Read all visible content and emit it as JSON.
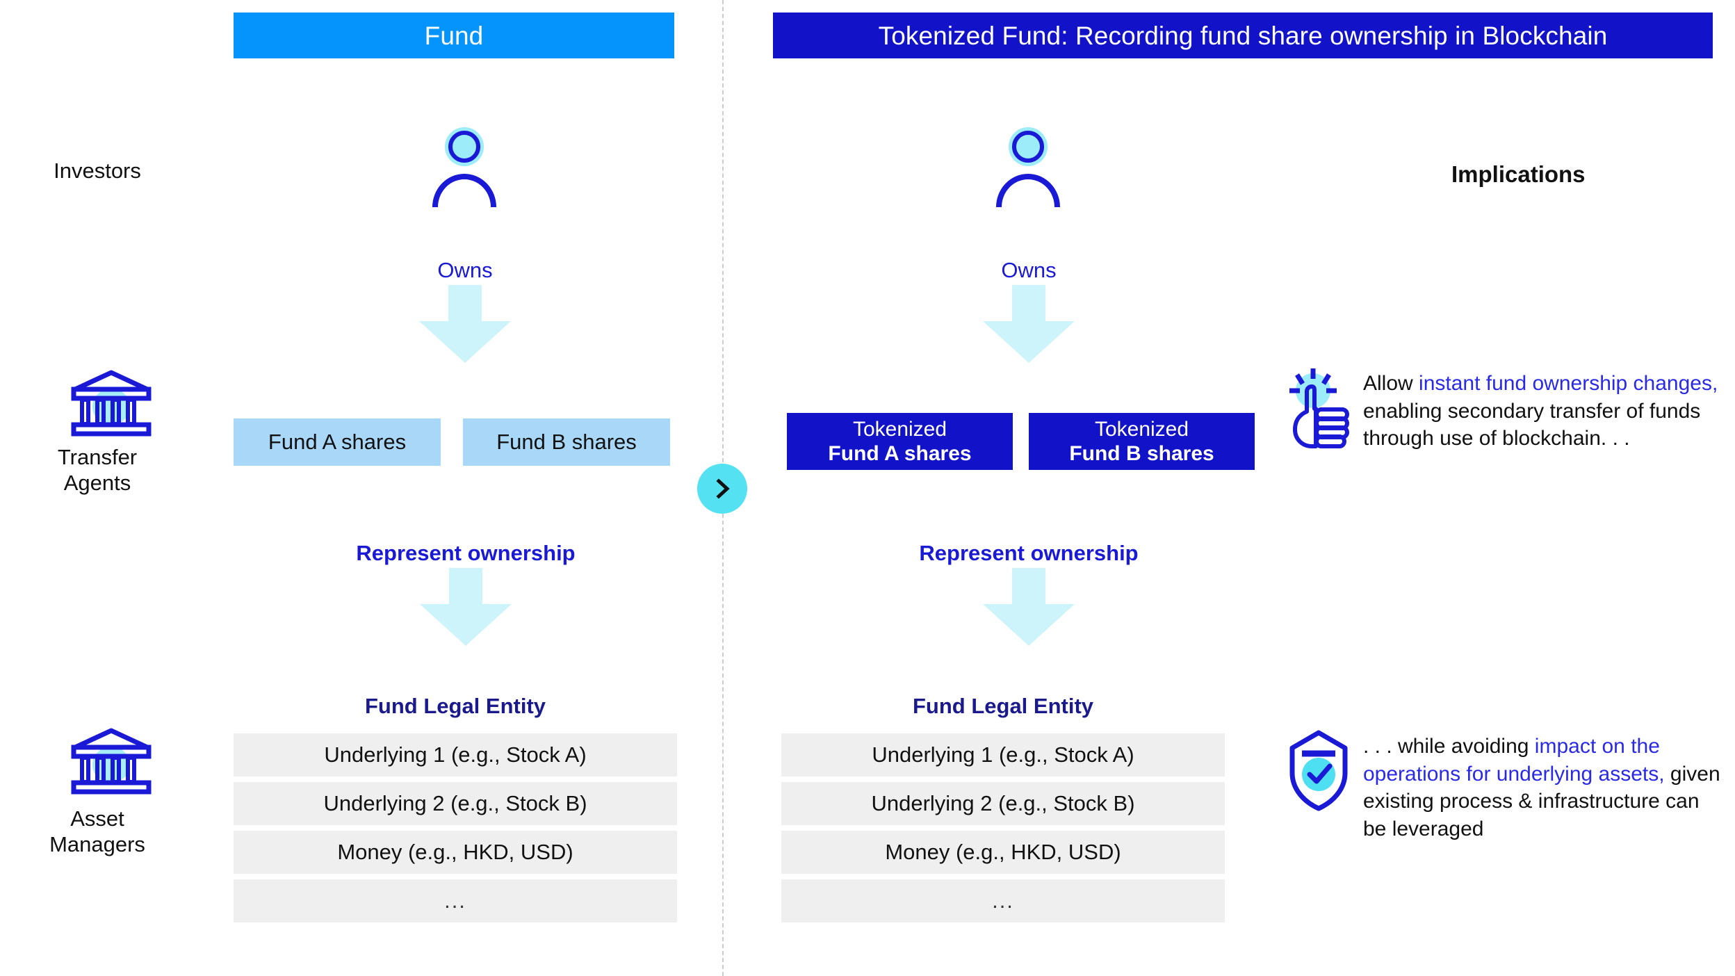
{
  "colors": {
    "azure": "#0593fc",
    "deep_blue": "#1212c8",
    "cyan": "#54e1f2",
    "light_cyan_arrow": "#cdf3fb",
    "light_blue_box": "#a8d7f8",
    "row_grey": "#efefef",
    "highlight_text": "#2a2ae6",
    "navy_title": "#1a1a8c"
  },
  "banners": {
    "left": "Fund",
    "right": "Tokenized Fund: Recording fund share ownership in Blockchain"
  },
  "divider": {
    "badge_icon": "chevron-right-icon"
  },
  "stages": [
    {
      "label": "Investors",
      "icon": null
    },
    {
      "label": "Transfer\nAgents",
      "icon": "bank-icon"
    },
    {
      "label": "Asset\nManagers",
      "icon": "bank-icon"
    }
  ],
  "stage_labels": {
    "investors": "Investors",
    "transfer_agents_line1": "Transfer",
    "transfer_agents_line2": "Agents",
    "asset_managers_line1": "Asset",
    "asset_managers_line2": "Managers"
  },
  "connectors": {
    "owns": "Owns",
    "represent_ownership": "Represent ownership"
  },
  "left_column": {
    "shares": [
      {
        "label": "Fund A shares"
      },
      {
        "label": "Fund B shares"
      }
    ],
    "entity": {
      "title": "Fund Legal Entity",
      "rows": [
        "Underlying 1 (e.g., Stock A)",
        "Underlying 2 (e.g., Stock B)",
        "Money (e.g., HKD, USD)",
        "..."
      ]
    }
  },
  "right_column": {
    "shares": [
      {
        "line1": "Tokenized",
        "line2": "Fund A shares"
      },
      {
        "line1": "Tokenized",
        "line2": "Fund B shares"
      }
    ],
    "entity": {
      "title": "Fund Legal Entity",
      "rows": [
        "Underlying 1 (e.g., Stock A)",
        "Underlying 2 (e.g., Stock B)",
        "Money (e.g., HKD, USD)",
        "..."
      ]
    }
  },
  "implications": {
    "heading": "Implications",
    "items": [
      {
        "icon": "thumbs-up-idea-icon",
        "segments": [
          {
            "text": "Allow ",
            "highlight": false
          },
          {
            "text": "instant fund ownership changes,",
            "highlight": true
          },
          {
            "text": " enabling secondary transfer of funds through use of blockchain. . .",
            "highlight": false
          }
        ]
      },
      {
        "icon": "shield-check-icon",
        "segments": [
          {
            "text": ". . . while avoiding ",
            "highlight": false
          },
          {
            "text": "impact on the operations for underlying assets,",
            "highlight": true
          },
          {
            "text": " given existing process & infrastructure can be leveraged",
            "highlight": false
          }
        ]
      }
    ]
  }
}
